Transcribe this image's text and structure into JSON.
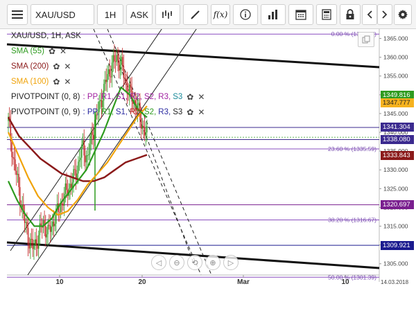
{
  "toolbar": {
    "symbol": "XAU/USD",
    "interval": "1H",
    "price_type": "ASK",
    "icons": [
      "menu-icon",
      "chart-type-icon",
      "draw-icon",
      "function-icon",
      "info-icon",
      "volume-icon",
      "calendar-icon",
      "calculator-icon",
      "lock-icon",
      "prev-icon",
      "next-icon",
      "settings-icon"
    ]
  },
  "legend": {
    "title": "XAU/USD, 1H, ASK",
    "sma55": {
      "label": "SMA (55)",
      "color": "#2e9b1f"
    },
    "sma200": {
      "label": "SMA (200)",
      "color": "#8b1a1a"
    },
    "sma100": {
      "label": "SMA (100)",
      "color": "#f0a30a"
    },
    "pivot1": {
      "label": "PIVOTPOINT (0, 8)",
      "parts": [
        ": PP,",
        "R1,",
        "S1,",
        "R2,",
        "S2,",
        "R3,",
        "S3"
      ]
    },
    "pivot2": {
      "label": "PIVOTPOINT (0, 9)",
      "parts": [
        ": PP,",
        "R1,",
        "S1,",
        "R2,",
        "S2,",
        "R3,",
        "S3"
      ]
    }
  },
  "axis": {
    "y_ticks": [
      "1365.000",
      "1360.000",
      "1355.000",
      "1350.000",
      "1345.000",
      "1340.000",
      "1335.000",
      "1330.000",
      "1325.000",
      "1320.000",
      "1315.000",
      "1310.000",
      "1305.000"
    ],
    "x_ticks": [
      "10",
      "20",
      "Mar",
      "10"
    ],
    "date_label": "14.03.2018"
  },
  "fib": [
    {
      "label": "0.00 % (1366.17)",
      "value": 1366.17
    },
    {
      "label": "23.60 % (1335.59)",
      "value": 1335.59
    },
    {
      "label": "38.20 % (1316.67)",
      "value": 1316.67
    },
    {
      "label": "50.00 % (1301.39)",
      "value": 1301.39
    }
  ],
  "price_tags": [
    {
      "label": "1349.816",
      "value": 1349.816,
      "color": "#2e9b1f",
      "text": "#ffffff"
    },
    {
      "label": "1347.777",
      "value": 1347.777,
      "color": "#f6b21e",
      "text": "#222222"
    },
    {
      "label": "1341.304",
      "value": 1341.304,
      "color": "#3b2a8f",
      "text": "#ffffff"
    },
    {
      "label": "1338.080",
      "value": 1338.08,
      "color": "#3b2a8f",
      "text": "#ffffff"
    },
    {
      "label": "1333.843",
      "value": 1333.843,
      "color": "#8b1a1a",
      "text": "#ffffff"
    },
    {
      "label": "1320.697",
      "value": 1320.697,
      "color": "#7a1f8f",
      "text": "#ffffff"
    },
    {
      "label": "1309.921",
      "value": 1309.921,
      "color": "#1b1b8f",
      "text": "#ffffff"
    }
  ],
  "chart_data": {
    "type": "candlestick",
    "symbol": "XAU/USD",
    "timeframe": "1H",
    "y_range": [
      1302,
      1367.5
    ],
    "horizontal_levels": [
      1366.17,
      1341.304,
      1338.08,
      1335.59,
      1320.697,
      1316.67,
      1309.921,
      1301.39
    ],
    "close_path": [
      1343,
      1333,
      1326,
      1318,
      1312,
      1309,
      1312,
      1316,
      1313,
      1316,
      1319,
      1322,
      1325,
      1327,
      1331,
      1336,
      1333,
      1340,
      1345,
      1350,
      1355,
      1358,
      1360,
      1357,
      1352,
      1349,
      1347,
      1342,
      1339
    ],
    "sma55": [
      1327,
      1322,
      1318,
      1315,
      1315,
      1317,
      1321,
      1324,
      1327,
      1330,
      1335,
      1340,
      1346,
      1352,
      1350,
      1346,
      1344
    ],
    "sma100": [
      1340,
      1334,
      1328,
      1323,
      1320,
      1318,
      1319,
      1322,
      1326,
      1329,
      1332,
      1336,
      1340,
      1344,
      1347
    ],
    "sma200": [
      1344,
      1339,
      1336,
      1333,
      1331,
      1329,
      1328,
      1327,
      1327,
      1328,
      1330,
      1332,
      1333,
      1334
    ]
  },
  "nav": {
    "icons": [
      "scroll-left-icon",
      "zoom-out-icon",
      "reset-icon",
      "zoom-in-icon",
      "scroll-right-icon"
    ]
  }
}
